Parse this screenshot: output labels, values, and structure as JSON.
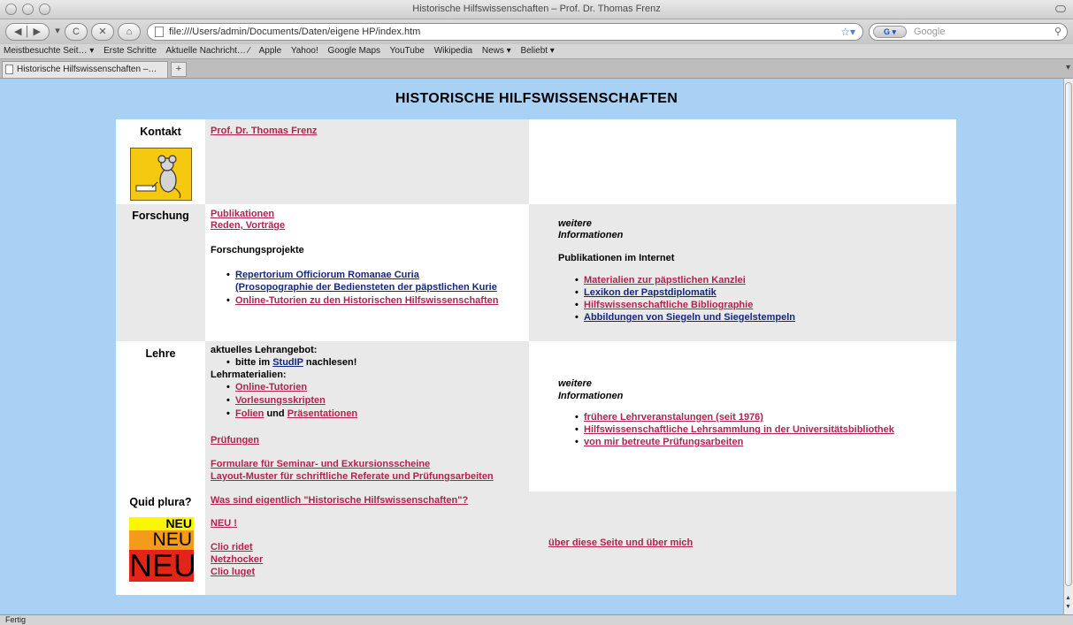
{
  "window": {
    "title": "Historische Hilfswissenschaften – Prof. Dr. Thomas Frenz"
  },
  "toolbar": {
    "back_icon": "back-arrow-icon",
    "reload_label": "C",
    "stop_label": "✕",
    "home_label": "⌂",
    "url": "file:///Users/admin/Documents/Daten/eigene HP/index.htm",
    "search_placeholder": "Google",
    "search_engine_label": "G"
  },
  "bookmarks": [
    "Meistbesuchte Seit… ▾",
    "Erste Schritte",
    "Aktuelle Nachricht… ⁄",
    "Apple",
    "Yahoo!",
    "Google Maps",
    "YouTube",
    "Wikipedia",
    "News ▾",
    "Beliebt ▾"
  ],
  "tab": {
    "label": "Historische Hilfswissenschaften –…",
    "new_tab": "+"
  },
  "statusbar": {
    "text": "Fertig"
  },
  "page": {
    "heading": "HISTORISCHE  HILFSWISSENSCHAFTEN",
    "kontakt": {
      "label": "Kontakt",
      "link": "Prof. Dr. Thomas Frenz"
    },
    "forschung": {
      "label": "Forschung",
      "links": [
        "Publikationen",
        "Reden, Vorträge"
      ],
      "projekte_heading": "Forschungsprojekte",
      "projekte": [
        "Repertorium Officiorum Romanae Curia",
        "(Prosopographie der Bediensteten der päpstlichen Kurie",
        "Online-Tutorien zu den Historischen Hilfswissenschaften"
      ],
      "weitere": "weitere",
      "informationen": "Informationen",
      "internet_heading": "Publikationen im Internet",
      "internet": [
        "Materialien zur päpstlichen Kanzlei",
        "Lexikon der Papstdiplomatik",
        "Hilfswissenschaftliche Bibliographie",
        "Abbildungen von Siegeln und Siegelstempeln"
      ]
    },
    "lehre": {
      "label": "Lehre",
      "angebot": "aktuelles Lehrangebot:",
      "bitte_pre": "bitte im",
      "studip": "StudIP",
      "bitte_post": "nachlesen!",
      "materialien": "Lehrmaterialien:",
      "mat_items": [
        "Online-Tutorien",
        "Vorlesungsskripten"
      ],
      "folien": "Folien",
      "und": "und",
      "praesentationen": "Präsentationen",
      "pruefungen": "Prüfungen",
      "formulare": "Formulare für Seminar- und Exkursionsscheine",
      "layout": "Layout-Muster für schriftliche Referate und Prüfungsarbeiten",
      "weitere": "weitere",
      "informationen": "Informationen",
      "more": [
        "frühere Lehrveranstalungen (seit 1976)",
        "Hilfswissenschaftliche Lehrsammlung in der Universitätsbibliothek",
        "von mir betreute Prüfungsarbeiten"
      ]
    },
    "quid": {
      "label": "Quid plura?",
      "question": "Was sind eigentlich \"Historische Hilfswissenschaften\"?",
      "neu_link": "NEU !",
      "links": [
        "Clio ridet",
        "Netzhocker",
        "Clio luget"
      ],
      "about": "über diese Seite und über mich",
      "neu_image": [
        "NEU",
        "NEU",
        "NEU"
      ]
    }
  }
}
